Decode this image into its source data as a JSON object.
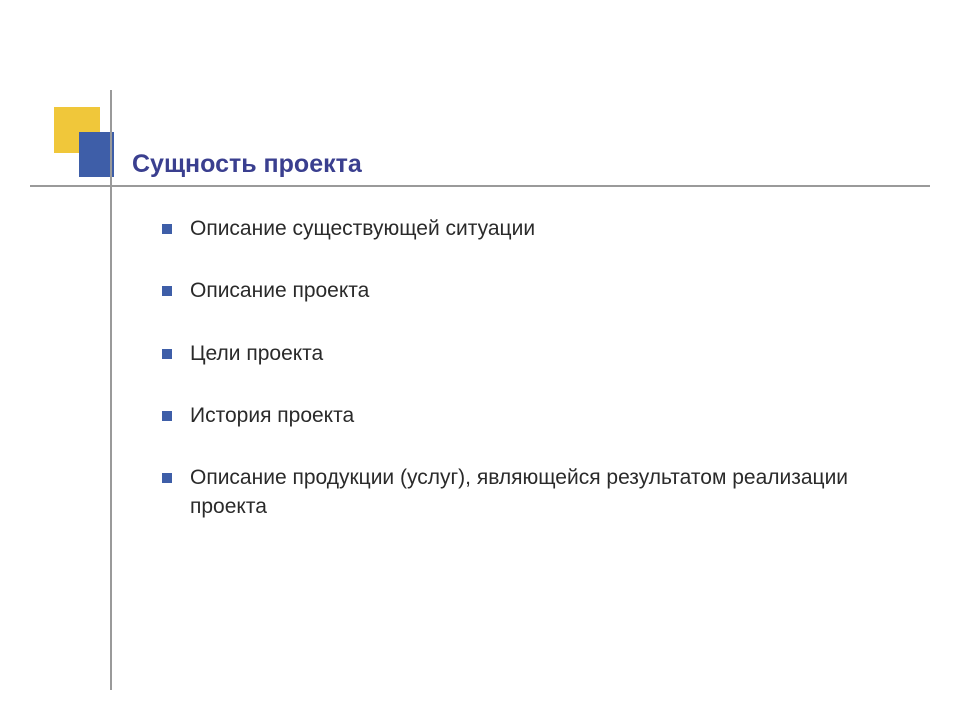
{
  "title": "Сущность проекта",
  "bullets": [
    "Описание существующей ситуации",
    "Описание проекта",
    "Цели проекта",
    "История проекта",
    "Описание продукции (услуг), являющейся результатом реализации проекта"
  ]
}
